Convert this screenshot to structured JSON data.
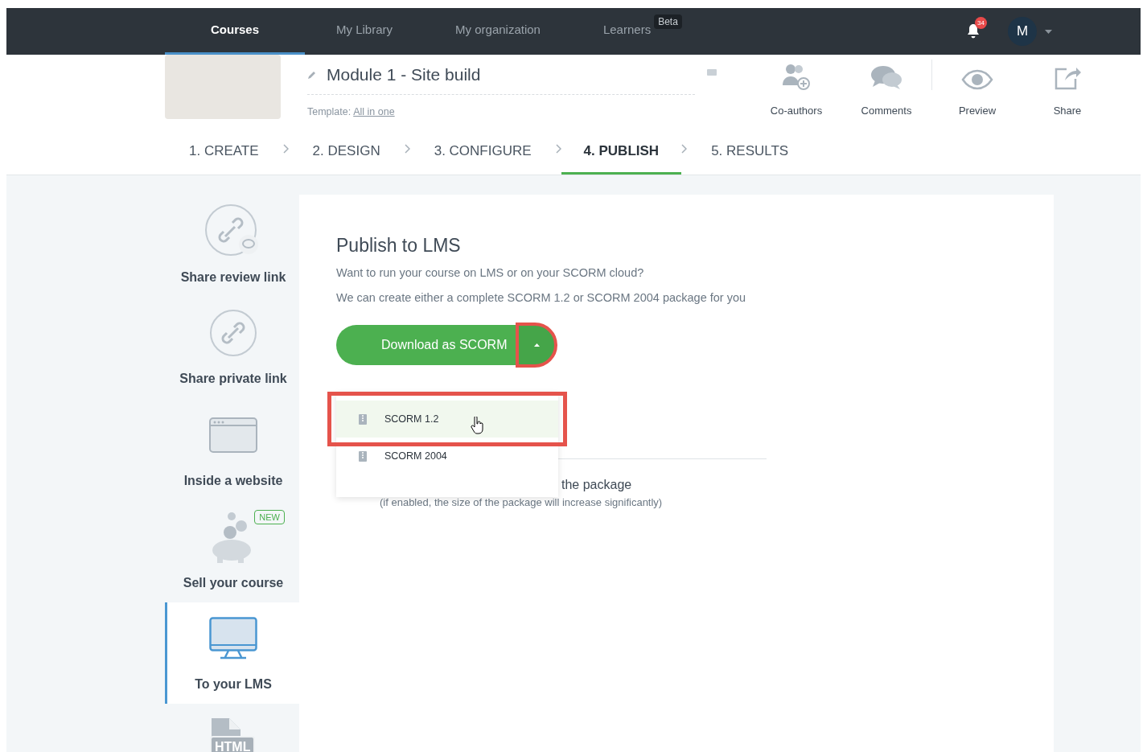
{
  "nav": {
    "tabs": [
      {
        "label": "Courses",
        "selected": true
      },
      {
        "label": "My Library",
        "selected": false
      },
      {
        "label": "My organization",
        "selected": false
      },
      {
        "label": "Learners",
        "selected": false,
        "badge": "Beta"
      }
    ],
    "notification_count": "34",
    "avatar": "M"
  },
  "course": {
    "title": "Module 1 - Site build",
    "template_label": "Template:",
    "template_link": "All in one"
  },
  "actions": [
    {
      "kind": "coauthors",
      "label": "Co-authors"
    },
    {
      "kind": "comments",
      "label": "Comments"
    },
    {
      "kind": "preview",
      "label": "Preview"
    },
    {
      "kind": "share",
      "label": "Share"
    }
  ],
  "steps": [
    {
      "label": "1. CREATE",
      "selected": false
    },
    {
      "label": "2. DESIGN",
      "selected": false
    },
    {
      "label": "3. CONFIGURE",
      "selected": false
    },
    {
      "label": "4. PUBLISH",
      "selected": true
    },
    {
      "label": "5. RESULTS",
      "selected": false
    }
  ],
  "sidebar": {
    "items": [
      {
        "kind": "review",
        "label": "Share review link",
        "selected": false
      },
      {
        "kind": "private",
        "label": "Share private link",
        "selected": false
      },
      {
        "kind": "website",
        "label": "Inside a website",
        "selected": false
      },
      {
        "kind": "sell",
        "label": "Sell your course",
        "badge": "NEW",
        "selected": false
      },
      {
        "kind": "lms",
        "label": "To your LMS",
        "selected": true
      },
      {
        "kind": "html",
        "icon_text": "HTML",
        "selected": false
      }
    ]
  },
  "panel": {
    "title": "Publish to LMS",
    "lines": [
      "Want to run your course on LMS or on your SCORM cloud?",
      "We can create either a complete SCORM 1.2 or SCORM 2004 package for you"
    ],
    "download_button": {
      "label": "Download as SCORM",
      "caret_highlighted": true
    },
    "dropdown": {
      "expanded": true,
      "items": [
        {
          "label": "SCORM 1.2",
          "selected": true,
          "highlighted": true
        },
        {
          "label": "SCORM 2004",
          "selected": false,
          "highlighted": false
        }
      ]
    },
    "option": {
      "label": "the package",
      "hint": "(if enabled, the size of the package will increase significantly)"
    }
  }
}
